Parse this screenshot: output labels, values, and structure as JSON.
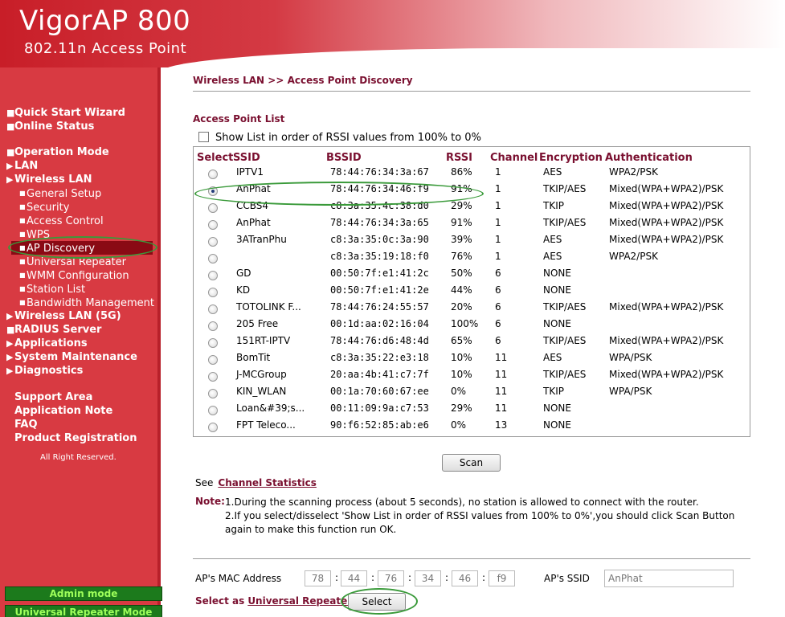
{
  "brand": {
    "title": "VigorAP 800",
    "subtitle": "802.11n Access Point"
  },
  "sidebar": {
    "group1": [
      "Quick Start Wizard",
      "Online Status"
    ],
    "group2": [
      "Operation Mode",
      "LAN",
      "Wireless LAN"
    ],
    "wireless_sub": [
      "General Setup",
      "Security",
      "Access Control",
      "WPS",
      "AP Discovery",
      "Universal Repeater",
      "WMM Configuration",
      "Station List",
      "Bandwidth Management"
    ],
    "group3": [
      "Wireless LAN (5G)",
      "RADIUS Server",
      "Applications",
      "System Maintenance",
      "Diagnostics"
    ],
    "support": [
      "Support Area",
      "Application Note",
      "FAQ",
      "Product Registration"
    ],
    "rights": "All Right Reserved.",
    "admin_mode": "Admin mode",
    "repeater_mode": "Universal Repeater Mode"
  },
  "main": {
    "breadcrumb": "Wireless LAN >> Access Point Discovery",
    "section_title": "Access Point List",
    "rssi_checkbox_label": "Show List in order of RSSI values from 100% to 0%",
    "headers": {
      "select": "Select",
      "ssid": "SSID",
      "bssid": "BSSID",
      "rssi": "RSSI",
      "channel": "Channel",
      "encryption": "Encryption",
      "authentication": "Authentication"
    },
    "rows": [
      {
        "ssid": "IPTV1",
        "bssid": "78:44:76:34:3a:67",
        "rssi": "86%",
        "channel": "1",
        "enc": "AES",
        "auth": "WPA2/PSK",
        "selected": false
      },
      {
        "ssid": "AnPhat",
        "bssid": "78:44:76:34:46:f9",
        "rssi": "91%",
        "channel": "1",
        "enc": "TKIP/AES",
        "auth": "Mixed(WPA+WPA2)/PSK",
        "selected": true
      },
      {
        "ssid": "CCBS4",
        "bssid": "c8:3a:35:4c:38:d0",
        "rssi": "29%",
        "channel": "1",
        "enc": "TKIP",
        "auth": "Mixed(WPA+WPA2)/PSK",
        "selected": false
      },
      {
        "ssid": "AnPhat",
        "bssid": "78:44:76:34:3a:65",
        "rssi": "91%",
        "channel": "1",
        "enc": "TKIP/AES",
        "auth": "Mixed(WPA+WPA2)/PSK",
        "selected": false
      },
      {
        "ssid": "3ATranPhu",
        "bssid": "c8:3a:35:0c:3a:90",
        "rssi": "39%",
        "channel": "1",
        "enc": "AES",
        "auth": "Mixed(WPA+WPA2)/PSK",
        "selected": false
      },
      {
        "ssid": "",
        "bssid": "c8:3a:35:19:18:f0",
        "rssi": "76%",
        "channel": "1",
        "enc": "AES",
        "auth": "WPA2/PSK",
        "selected": false
      },
      {
        "ssid": "GD",
        "bssid": "00:50:7f:e1:41:2c",
        "rssi": "50%",
        "channel": "6",
        "enc": "NONE",
        "auth": "",
        "selected": false
      },
      {
        "ssid": "KD",
        "bssid": "00:50:7f:e1:41:2e",
        "rssi": "44%",
        "channel": "6",
        "enc": "NONE",
        "auth": "",
        "selected": false
      },
      {
        "ssid": "TOTOLINK F...",
        "bssid": "78:44:76:24:55:57",
        "rssi": "20%",
        "channel": "6",
        "enc": "TKIP/AES",
        "auth": "Mixed(WPA+WPA2)/PSK",
        "selected": false
      },
      {
        "ssid": "205 Free",
        "bssid": "00:1d:aa:02:16:04",
        "rssi": "100%",
        "channel": "6",
        "enc": "NONE",
        "auth": "",
        "selected": false
      },
      {
        "ssid": "151RT-IPTV",
        "bssid": "78:44:76:d6:48:4d",
        "rssi": "65%",
        "channel": "6",
        "enc": "TKIP/AES",
        "auth": "Mixed(WPA+WPA2)/PSK",
        "selected": false
      },
      {
        "ssid": "BomTit",
        "bssid": "c8:3a:35:22:e3:18",
        "rssi": "10%",
        "channel": "11",
        "enc": "AES",
        "auth": "WPA/PSK",
        "selected": false
      },
      {
        "ssid": "J-MCGroup",
        "bssid": "20:aa:4b:41:c7:7f",
        "rssi": "10%",
        "channel": "11",
        "enc": "TKIP/AES",
        "auth": "Mixed(WPA+WPA2)/PSK",
        "selected": false
      },
      {
        "ssid": "KIN_WLAN",
        "bssid": "00:1a:70:60:67:ee",
        "rssi": "0%",
        "channel": "11",
        "enc": "TKIP",
        "auth": "WPA/PSK",
        "selected": false
      },
      {
        "ssid": "Loan&#39;s...",
        "bssid": "00:11:09:9a:c7:53",
        "rssi": "29%",
        "channel": "11",
        "enc": "NONE",
        "auth": "",
        "selected": false
      },
      {
        "ssid": "FPT Teleco...",
        "bssid": "90:f6:52:85:ab:e6",
        "rssi": "0%",
        "channel": "13",
        "enc": "NONE",
        "auth": "",
        "selected": false
      }
    ],
    "scan_button": "Scan",
    "see_prefix": "See",
    "channel_stats_link": "Channel Statistics",
    "note_label": "Note:",
    "note_1": "1.During the scanning process (about 5 seconds), no station is allowed to connect with the router.",
    "note_2": "2.If you select/disselect 'Show List in order of RSSI values from 100% to 0%',you should click Scan Button again to make this function run OK.",
    "mac_label": "AP's MAC Address",
    "mac": [
      "78",
      "44",
      "76",
      "34",
      "46",
      "f9"
    ],
    "mac_separator": ":",
    "ssid_label": "AP's SSID",
    "ssid_value": "AnPhat",
    "select_as": "Select as",
    "repeater_link": "Universal Repeater",
    "select_suffix": ":",
    "select_button": "Select"
  },
  "colors": {
    "accent": "#7a1030",
    "sidebar": "#d83a42",
    "highlight": "#3a9a3a"
  }
}
